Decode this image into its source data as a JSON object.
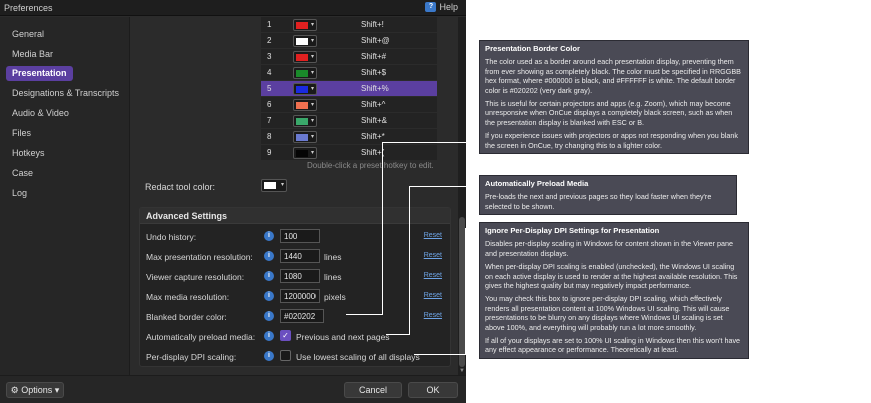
{
  "window": {
    "title": "Preferences",
    "help_label": "Help"
  },
  "sidebar": {
    "items": [
      {
        "label": "General"
      },
      {
        "label": "Media Bar"
      },
      {
        "label": "Presentation"
      },
      {
        "label": "Designations & Transcripts"
      },
      {
        "label": "Audio & Video"
      },
      {
        "label": "Files"
      },
      {
        "label": "Hotkeys"
      },
      {
        "label": "Case"
      },
      {
        "label": "Log"
      }
    ],
    "active": "Presentation"
  },
  "hotkeys": {
    "rows": [
      {
        "num": "1",
        "color": "#e02020",
        "key": "Shift+!"
      },
      {
        "num": "2",
        "color": "#ffffff",
        "key": "Shift+@"
      },
      {
        "num": "3",
        "color": "#e02020",
        "key": "Shift+#"
      },
      {
        "num": "4",
        "color": "#1a8a2a",
        "key": "Shift+$"
      },
      {
        "num": "5",
        "color": "#1a2ae0",
        "key": "Shift+%"
      },
      {
        "num": "6",
        "color": "#f07050",
        "key": "Shift+^"
      },
      {
        "num": "7",
        "color": "#3aa86a",
        "key": "Shift+&"
      },
      {
        "num": "8",
        "color": "#6a7ad0",
        "key": "Shift+*"
      },
      {
        "num": "9",
        "color": "#050505",
        "key": "Shift+("
      }
    ],
    "selected_row": "5",
    "hint": "Double-click a preset hotkey to edit."
  },
  "redact": {
    "label": "Redact tool color:",
    "color": "#ffffff"
  },
  "advanced": {
    "title": "Advanced Settings",
    "reset_label": "Reset",
    "undo": {
      "label": "Undo history:",
      "value": "100"
    },
    "max_pres_res": {
      "label": "Max presentation resolution:",
      "value": "1440",
      "unit": "lines"
    },
    "viewer_res": {
      "label": "Viewer capture resolution:",
      "value": "1080",
      "unit": "lines"
    },
    "max_media_res": {
      "label": "Max media resolution:",
      "value": "12000000",
      "unit": "pixels"
    },
    "border_color": {
      "label": "Blanked border color:",
      "value": "#020202"
    },
    "preload": {
      "label": "Automatically preload media:",
      "checked": true,
      "text": "Previous and next pages"
    },
    "dpi": {
      "label": "Per-display DPI scaling:",
      "checked": false,
      "text": "Use lowest scaling of all displays"
    }
  },
  "footer": {
    "options_label": "Options",
    "cancel_label": "Cancel",
    "ok_label": "OK"
  },
  "tooltips": {
    "border": {
      "title": "Presentation Border Color",
      "p1": "The color used as a border around each presentation display, preventing them from ever showing as completely black. The color must be specified in RRGGBB hex format, where #000000 is black, and #FFFFFF is white. The default border color is #020202 (very dark gray).",
      "p2": "This is useful for certain projectors and apps (e.g. Zoom), which may become unresponsive when OnCue displays a completely black screen, such as when the presentation display is blanked with ESC or B.",
      "p3": "If you experience issues with projectors or apps not responding when you blank the screen in OnCue, try changing this to a lighter color."
    },
    "preload": {
      "title": "Automatically Preload Media",
      "p1": "Pre-loads the next and previous pages so they load faster when they're selected to be shown."
    },
    "dpi": {
      "title": "Ignore Per-Display DPI Settings for Presentation",
      "p1": "Disables per-display scaling in Windows for content shown in the Viewer pane and presentation displays.",
      "p2": "When per-display DPI scaling is enabled (unchecked), the Windows UI scaling on each active display is used to render at the highest available resolution. This gives the highest quality but may negatively impact performance.",
      "p3": "You may check this box to ignore per-display DPI scaling, which effectively renders all presentation content at 100% Windows UI scaling. This will cause presentations to be blurry on any displays where Windows UI scaling is set above 100%, and everything will probably run a lot more smoothly.",
      "p4": "If all of your displays are set to 100% UI scaling in Windows then this won't have any effect appearance or performance. Theoretically at least."
    }
  }
}
